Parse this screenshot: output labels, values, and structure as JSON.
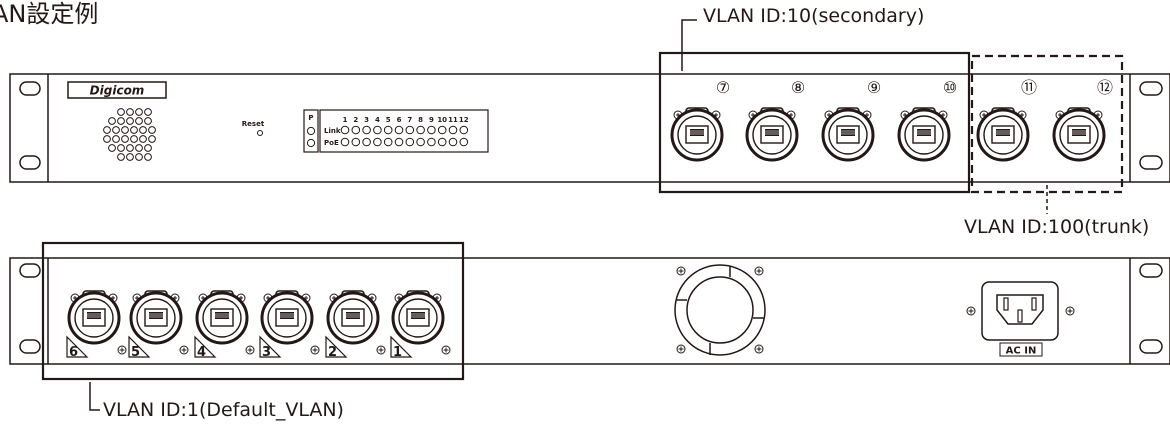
{
  "title": "AN設定例",
  "front_panel": {
    "logo": "Digicom",
    "reset_label": "Reset",
    "p_label": "P",
    "link_label": "Link",
    "poe_label": "PoE",
    "led_numbers": [
      "1",
      "2",
      "3",
      "4",
      "5",
      "6",
      "7",
      "8",
      "9",
      "10",
      "11",
      "12"
    ],
    "ports": [
      {
        "num": "7",
        "badge": "⑦",
        "vlan": "secondary"
      },
      {
        "num": "8",
        "badge": "⑧",
        "vlan": "secondary"
      },
      {
        "num": "9",
        "badge": "⑨",
        "vlan": "secondary"
      },
      {
        "num": "10",
        "badge": "⑩",
        "vlan": "secondary"
      },
      {
        "num": "11",
        "badge": "⑪",
        "vlan": "trunk"
      },
      {
        "num": "12",
        "badge": "⑫",
        "vlan": "trunk"
      }
    ]
  },
  "rear_panel": {
    "ports": [
      "6",
      "5",
      "4",
      "3",
      "2",
      "1"
    ],
    "ac_label": "AC IN"
  },
  "callouts": {
    "secondary": "VLAN ID:10(secondary)",
    "trunk": "VLAN ID:100(trunk)",
    "default": "VLAN ID:1(Default_VLAN)"
  }
}
